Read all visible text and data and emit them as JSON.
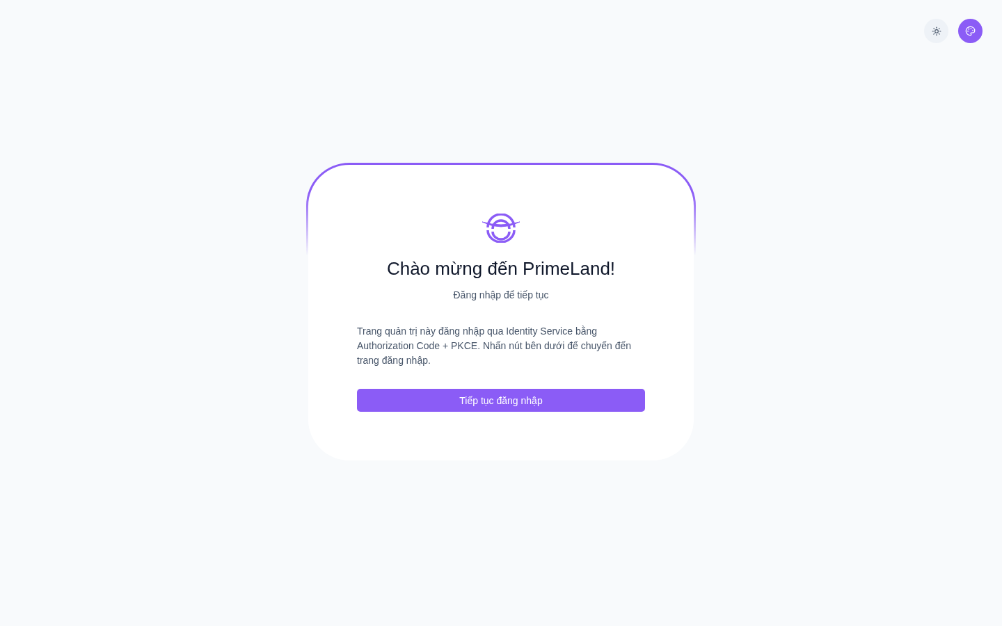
{
  "header": {
    "theme_toggle": {
      "on": false
    },
    "palette_button": {
      "selected": true
    }
  },
  "card": {
    "title": "Chào mừng đến PrimeLand!",
    "subtitle": "Đăng nhập để tiếp tục",
    "description": "Trang quản trị này đăng nhập qua Identity Service bằng Authorization Code + PKCE. Nhấn nút bên dưới để chuyển đến trang đăng nhập.",
    "button": "Tiếp tục đăng nhập"
  }
}
